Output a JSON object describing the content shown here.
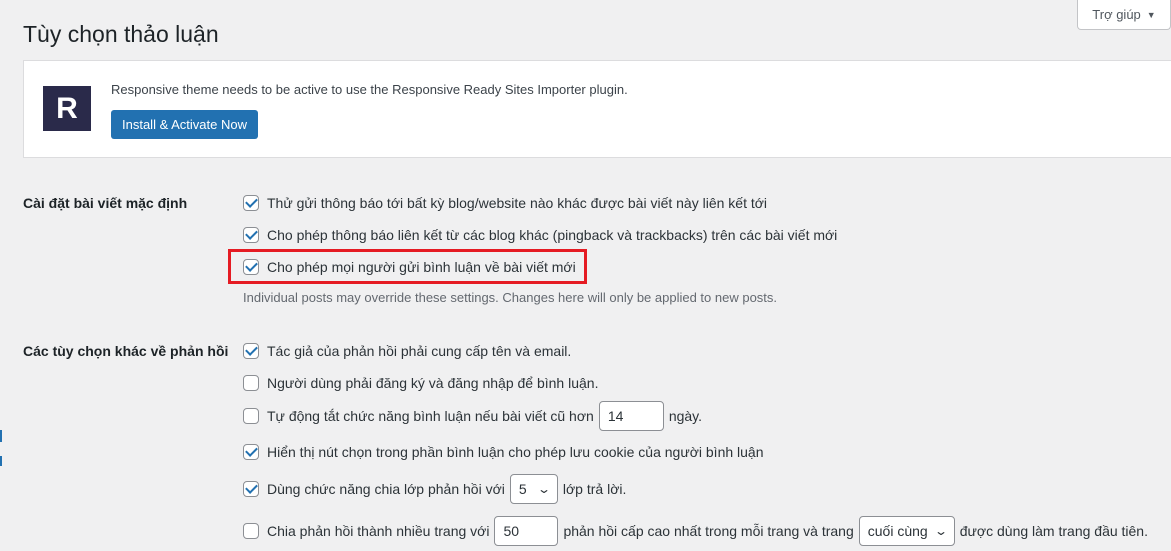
{
  "help_tab": {
    "label": "Trợ giúp"
  },
  "page_title": "Tùy chọn thảo luận",
  "notice": {
    "logo_letter": "R",
    "message": "Responsive theme needs to be active to use the Responsive Ready Sites Importer plugin.",
    "button_label": "Install & Activate Now"
  },
  "default_settings": {
    "label": "Cài đặt bài viết mặc định",
    "options": [
      {
        "label": "Thử gửi thông báo tới bất kỳ blog/website nào khác được bài viết này liên kết tới",
        "checked": true
      },
      {
        "label": "Cho phép thông báo liên kết từ các blog khác (pingback và trackbacks) trên các bài viết mới",
        "checked": true
      },
      {
        "label": "Cho phép mọi người gửi bình luận về bài viết mới",
        "checked": true
      }
    ],
    "description": "Individual posts may override these settings. Changes here will only be applied to new posts."
  },
  "other_options": {
    "label": "Các tùy chọn khác về phản hồi",
    "opt1": "Tác giả của phản hồi phải cung cấp tên và email.",
    "opt2": "Người dùng phải đăng ký và đăng nhập để bình luận.",
    "opt3_before": "Tự động tắt chức năng bình luận nếu bài viết cũ hơn",
    "opt3_value": "14",
    "opt3_after": "ngày.",
    "opt4": "Hiển thị nút chọn trong phần bình luận cho phép lưu cookie của người bình luận",
    "opt5_before": "Dùng chức năng chia lớp phản hồi với",
    "opt5_value": "5",
    "opt5_after": "lớp trả lời.",
    "opt6_before": "Chia phản hồi thành nhiều trang với",
    "opt6_value": "50",
    "opt6_middle": "phản hồi cấp cao nhất trong mỗi trang và trang",
    "opt6_select": "cuối cùng",
    "opt6_after": "được dùng làm trang đầu tiên."
  },
  "colors": {
    "accent": "#2271b1",
    "highlight": "#e51b23",
    "background": "#f0f0f1"
  }
}
